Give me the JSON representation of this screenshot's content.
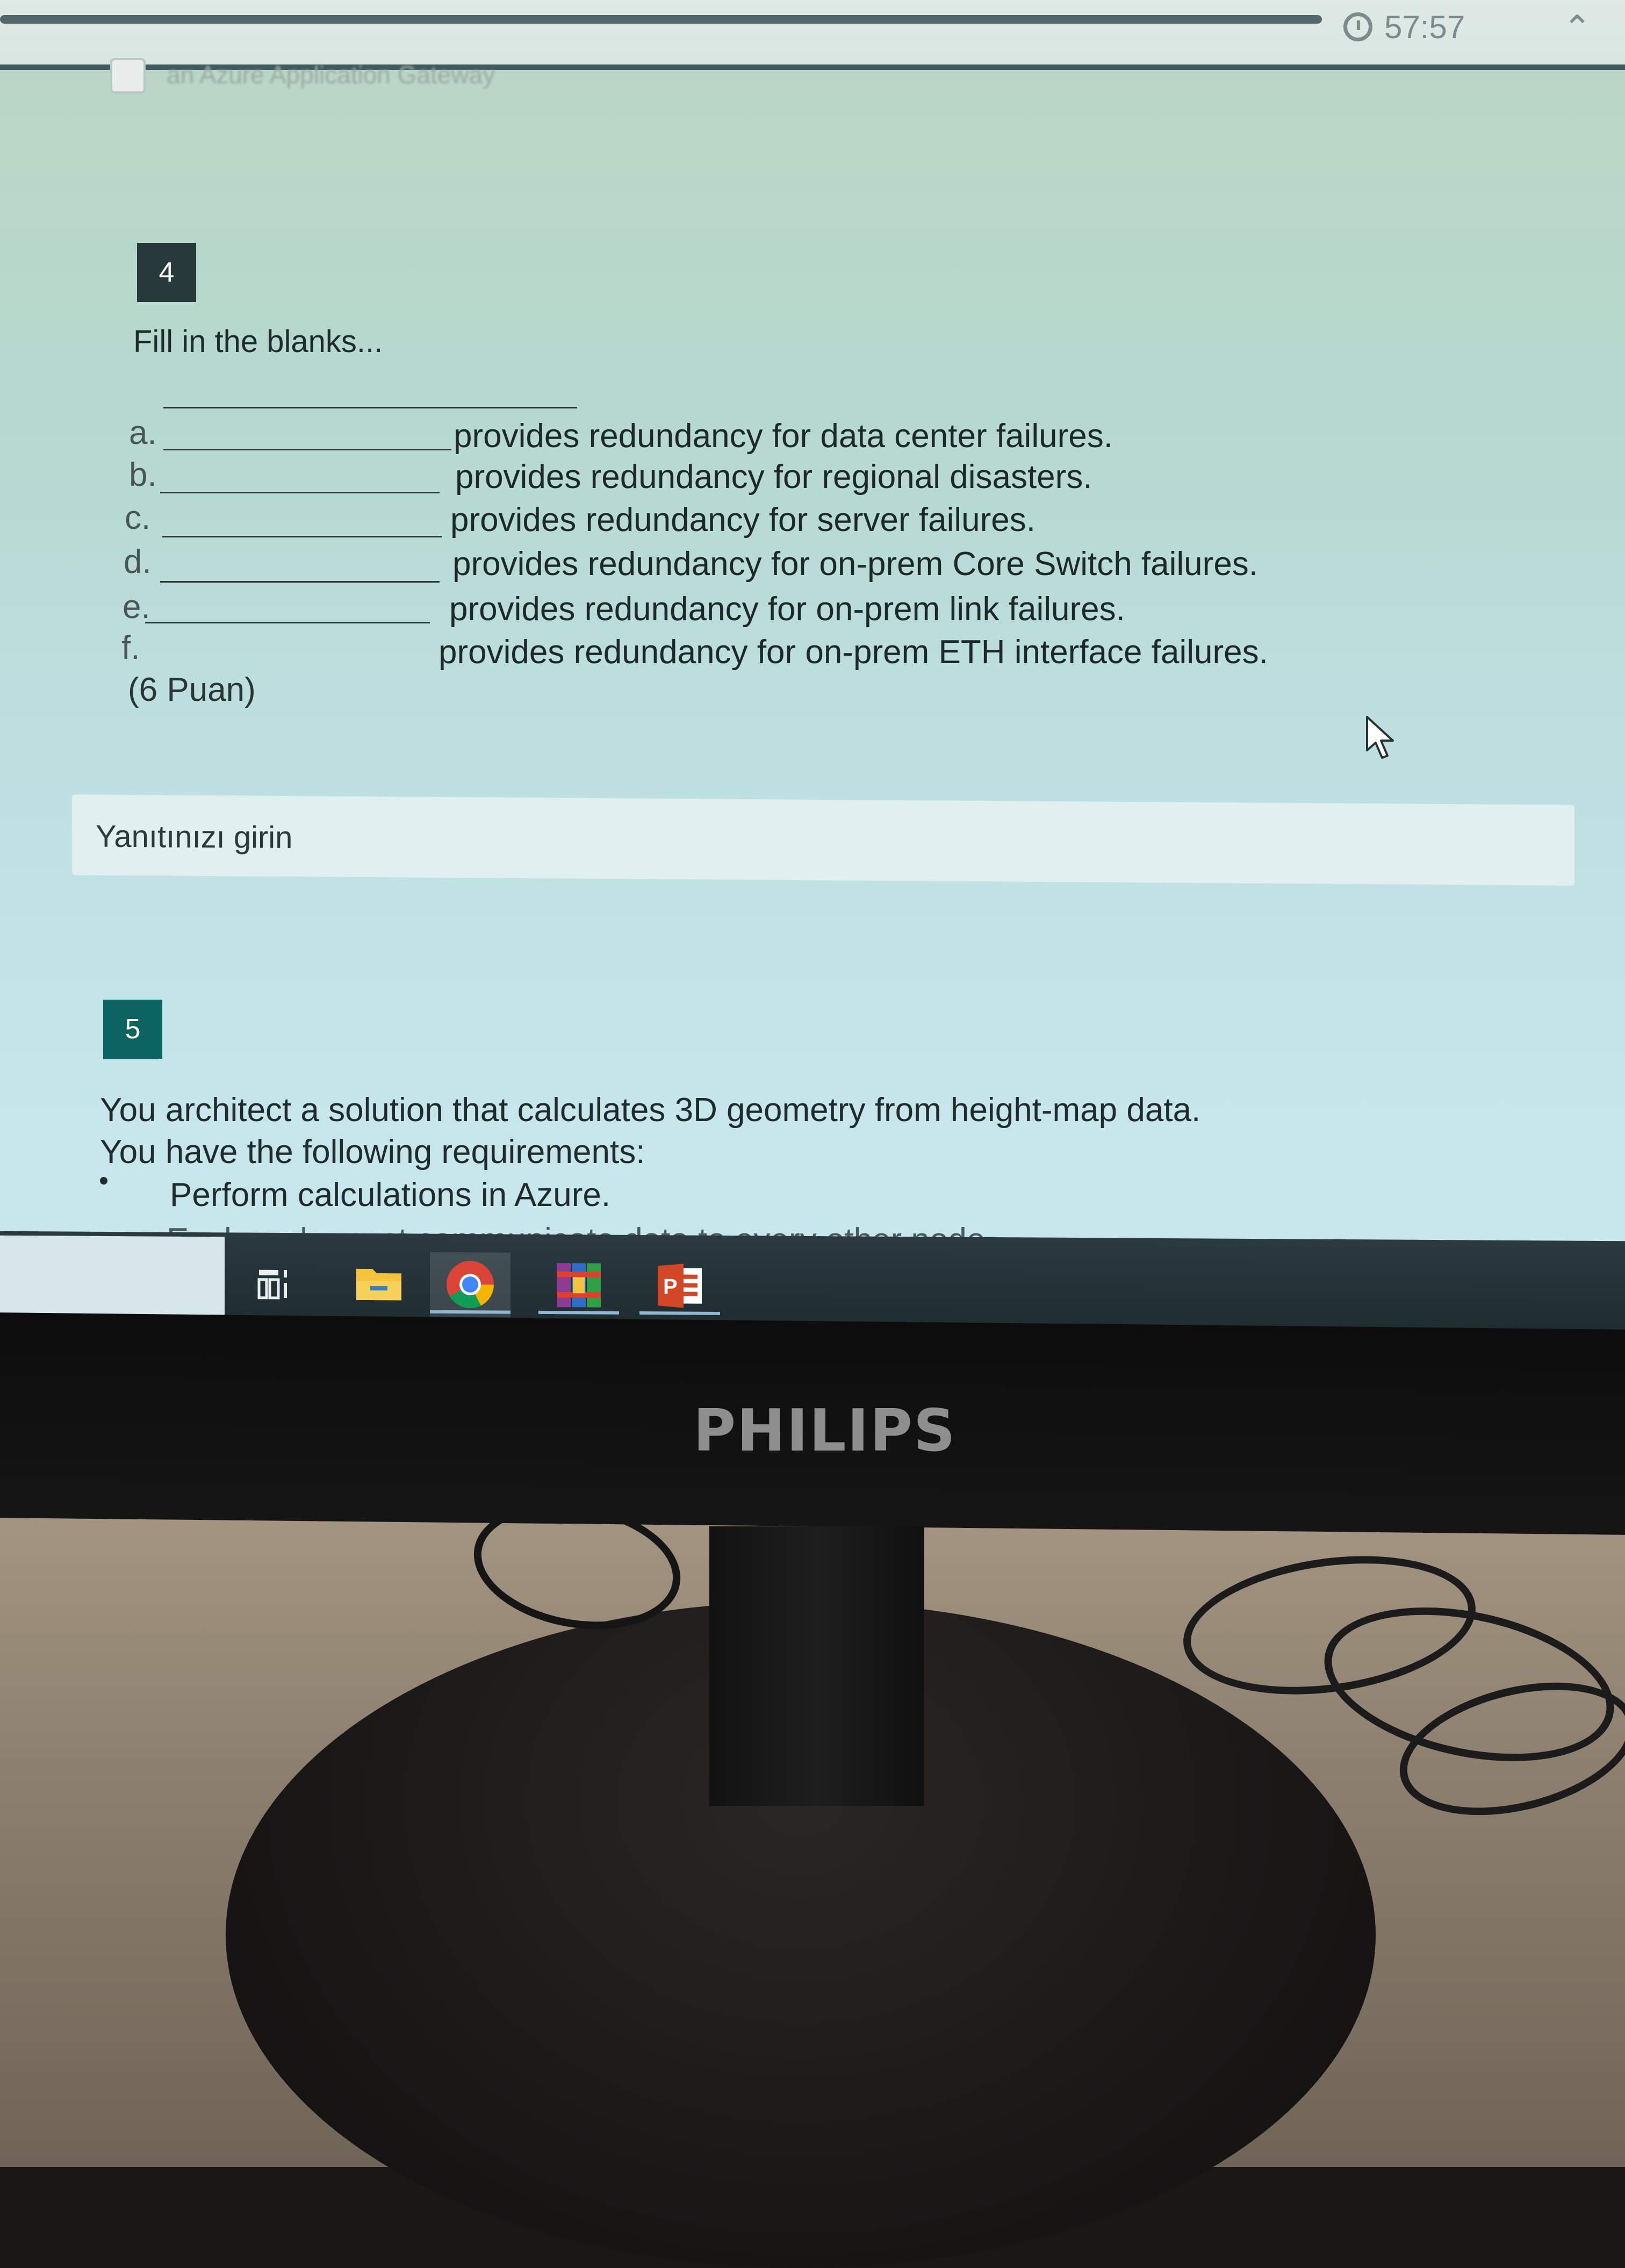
{
  "timer": {
    "value": "57:57",
    "icon": "stopwatch-icon"
  },
  "previous_question": {
    "text": "an Azure Application Gateway"
  },
  "question4": {
    "number": "4",
    "title": "Fill in the blanks...",
    "items": [
      {
        "letter": "a.",
        "text": "provides redundancy for data center failures."
      },
      {
        "letter": "b.",
        "text": "provides redundancy for regional disasters."
      },
      {
        "letter": "c.",
        "text": "provides redundancy for server failures."
      },
      {
        "letter": "d.",
        "text": "provides redundancy for on-prem Core Switch failures."
      },
      {
        "letter": "e.",
        "text": "provides redundancy for on-prem link failures."
      },
      {
        "letter": "f.",
        "text": "provides redundancy for on-prem ETH interface failures."
      }
    ],
    "points": "(6 Puan)",
    "answer_placeholder": "Yanıtınızı girin"
  },
  "question5": {
    "number": "5",
    "line1": "You architect a solution that calculates 3D geometry from height-map data.",
    "line2": "You have the following requirements:",
    "bullet1": "Perform calculations in Azure.",
    "bullet2": "Each node must communicate data to every other node."
  },
  "taskbar": {
    "icons": [
      "task-view-icon",
      "file-explorer-icon",
      "chrome-icon",
      "winrar-icon",
      "powerpoint-icon"
    ]
  },
  "monitor": {
    "brand": "PHILIPS"
  }
}
